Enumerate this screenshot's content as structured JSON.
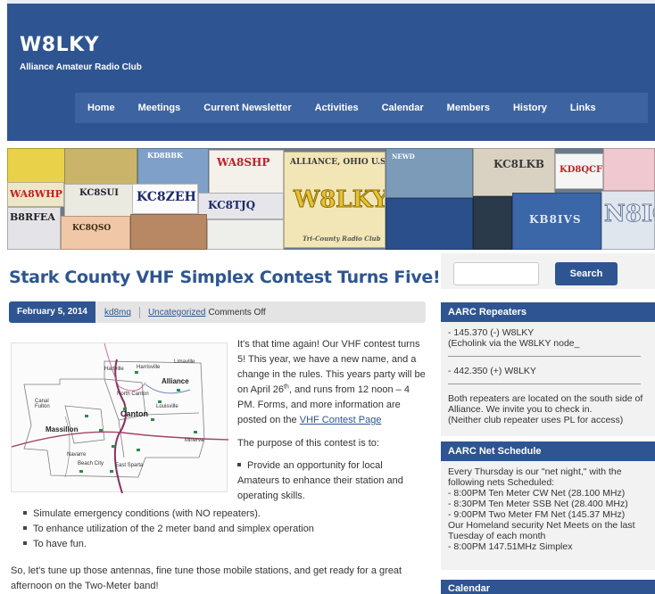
{
  "site": {
    "title": "W8LKY",
    "tagline": "Alliance Amateur Radio Club"
  },
  "nav": [
    "Home",
    "Meetings",
    "Current Newsletter",
    "Activities",
    "Calendar",
    "Members",
    "History",
    "Links"
  ],
  "banner": {
    "cards": [
      "KD8BBK",
      "WA8SHP",
      "ALLIANCE, OHIO U.S.A.",
      "W8LKY",
      "Tri-County Radio Club",
      "KC8LKB",
      "KD8QCF",
      "WA8WHP",
      "KC8SUI",
      "KC8ZEH",
      "KC8TJQ",
      "B8RFEA",
      "KC8QSO",
      "KB8IVS",
      "N8IG",
      "NEWD"
    ]
  },
  "post": {
    "title": "Stark County VHF Simplex Contest Turns Five!",
    "date": "February 5, 2014",
    "author": "kd8mq",
    "category": "Uncategorized",
    "comments": "Comments Off",
    "intro_part1": "It's that time again! Our VHF contest turns 5! This year, we have a new name, and a change in the rules. This years party will be on April 26",
    "intro_sup": "th",
    "intro_part2": ", and runs from 12 noon – 4 PM. Forms, and more information are posted on the ",
    "intro_link": "VHF Contest Page",
    "purpose": "The purpose of this contest is to:",
    "bullet_first": "Provide an opportunity for local Amateurs to enhance their station and operating skills.",
    "bullets": [
      "Simulate emergency conditions (with NO repeaters).",
      "To enhance utilization of the 2 meter band and simplex operation",
      "To have fun."
    ],
    "closing": "So, let's tune up those antennas, fine tune those mobile stations, and get ready for a great afternoon on the Two-Meter band!"
  },
  "map": {
    "cities": [
      "Harrisville",
      "Alliance",
      "North Canton",
      "Canton",
      "Louisville",
      "Canal Fulton",
      "Massillon",
      "Navarre",
      "Beach City",
      "East Sparta",
      "Minerva",
      "Limaville",
      "Hartville"
    ]
  },
  "sidebar": {
    "search_button": "Search",
    "search_placeholder": "",
    "repeaters": {
      "heading": "AARC Repeaters",
      "lines1": [
        "- 145.370 (-) W8LKY",
        "(Echolink via the W8LKY node_"
      ],
      "lines2": [
        "- 442.350 (+) W8LKY"
      ],
      "lines3": [
        "Both repeaters are located on the south side of",
        "Alliance. We invite you to check in.",
        "(Neither club repeater uses PL for access)"
      ]
    },
    "net": {
      "heading": "AARC Net Schedule",
      "lines": [
        "Every Thursday is our \"net night,\" with the",
        "following nets Scheduled:",
        "- 8:00PM Ten Meter CW Net (28.100 MHz)",
        "- 8:30PM Ten Meter SSB Net (28.400 MHz)",
        "- 9:00PM Two Meter FM Net (145.37 MHz)",
        "Our Homeland security Net Meets on the last",
        "Tuesday of each month",
        "- 8:00PM 147.51MHz Simplex"
      ]
    },
    "calendar": {
      "heading": "Calendar"
    }
  },
  "colors": {
    "brand_blue": "#2e5591",
    "nav_blue": "#3d64a0",
    "panel_gray": "#f2f2f2"
  }
}
